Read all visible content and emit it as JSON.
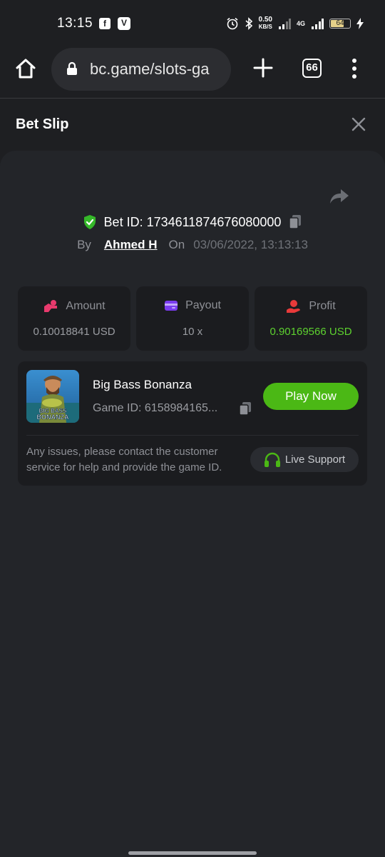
{
  "status_bar": {
    "time": "13:15",
    "app_icons": [
      "facebook-icon",
      "vpn-icon"
    ],
    "net_speed_value": "0.50",
    "net_speed_unit": "KB/S",
    "network_label": "4G",
    "battery": "64"
  },
  "browser": {
    "url": "bc.game/slots-ga",
    "tab_count": "66"
  },
  "slip": {
    "title": "Bet Slip",
    "bet_id": "Bet ID: 1734611874676080000",
    "by_label": "By",
    "user": "Ahmed H",
    "on_label": "On",
    "datetime": "03/06/2022, 13:13:13"
  },
  "stats": {
    "amount": {
      "label": "Amount",
      "value": "0.10018841 USD"
    },
    "payout": {
      "label": "Payout",
      "value": "10 x"
    },
    "profit": {
      "label": "Profit",
      "value": "0.90169566 USD"
    }
  },
  "game": {
    "name": "Big Bass Bonanza",
    "thumb_line1": "BIG BASS",
    "thumb_line2": "BONANZA",
    "game_id": "Game ID: 6158984165...",
    "play_label": "Play Now",
    "support_text": "Any issues, please contact the customer service for help and provide the game ID.",
    "support_label": "Live Support"
  },
  "colors": {
    "accent_green": "#4bb815",
    "profit_green": "#5dd12f",
    "panel": "#232529",
    "card": "#1b1c1f"
  }
}
